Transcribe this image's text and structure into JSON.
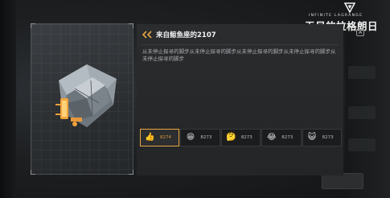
{
  "brand": {
    "en": "INFINITE LAGRANGE",
    "cn": "无尽的拉格朗日",
    "key_hint": "A",
    "accent": "#e8a640"
  },
  "post": {
    "author_title": "来自鲸鱼座的2107",
    "body": "从未停止探寻的脚步从未停止探寻的脚步从未停止探寻的脚步从未停止探寻的脚步从未停止探寻的脚步",
    "reactions": [
      {
        "icon": "thumbs-up-icon",
        "glyph": "👍",
        "count": "8274",
        "active": true
      },
      {
        "icon": "grin-icon",
        "glyph": "😁",
        "count": "8273",
        "active": false
      },
      {
        "icon": "thinking-icon",
        "glyph": "🤔",
        "count": "8273",
        "active": false
      },
      {
        "icon": "laugh-tears-icon",
        "glyph": "😂",
        "count": "8273",
        "active": false
      },
      {
        "icon": "cat-face-icon",
        "glyph": "😺",
        "count": "8273",
        "active": false
      }
    ]
  }
}
